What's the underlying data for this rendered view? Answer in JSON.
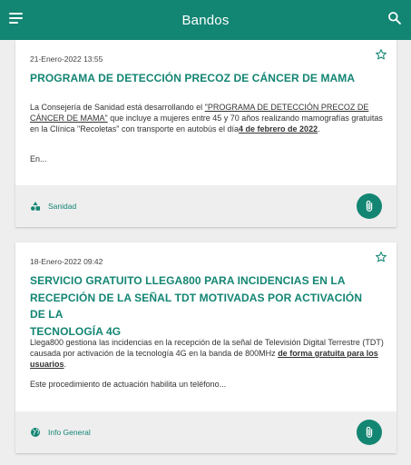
{
  "header": {
    "title": "Bandos"
  },
  "colors": {
    "accent": "#138573",
    "background": "#eeeeee"
  },
  "posts": [
    {
      "date": "21-Enero-2022 13:55",
      "title_lines": [
        "PROGRAMA DE DETECCIÓN PRECOZ DE CÁNCER DE MAMA"
      ],
      "body": {
        "p1": "La Consejería de Sanidad está desarrollando el ",
        "link": "\"PROGRAMA DE DETECCIÓN PRECOZ DE CÁNCER DE MAMA\"",
        "p2": " que incluye a mujeres entre 45 y 70 años realizando mamografías gratuitas en la Clínica \"Recoletas\" con transporte en autobús el día",
        "bold": "4 de febrero de 2022",
        "p3": "."
      },
      "more": "En...",
      "category": {
        "label": "Sanidad",
        "icon": "shapes-icon"
      }
    },
    {
      "date": "18-Enero-2022 09:42",
      "title_lines": [
        "SERVICIO GRATUITO LLEGA800 PARA INCIDENCIAS EN LA",
        "RECEPCIÓN DE LA SEÑAL TDT MOTIVADAS POR ACTIVACIÓN DE LA",
        "TECNOLOGÍA 4G"
      ],
      "body": {
        "p1": "Llega800 gestiona las incidencias en la recepción de la señal de Televisión Digital Terrestre (TDT) causada por activación de la tecnología 4G en la banda de 800MHz ",
        "bold": "de forma gratuita para los usuarios",
        "p2": "."
      },
      "more": " Este procedimiento de actuación habilita un teléfono...",
      "category": {
        "label": "Info General",
        "icon": "globe-icon"
      }
    }
  ]
}
